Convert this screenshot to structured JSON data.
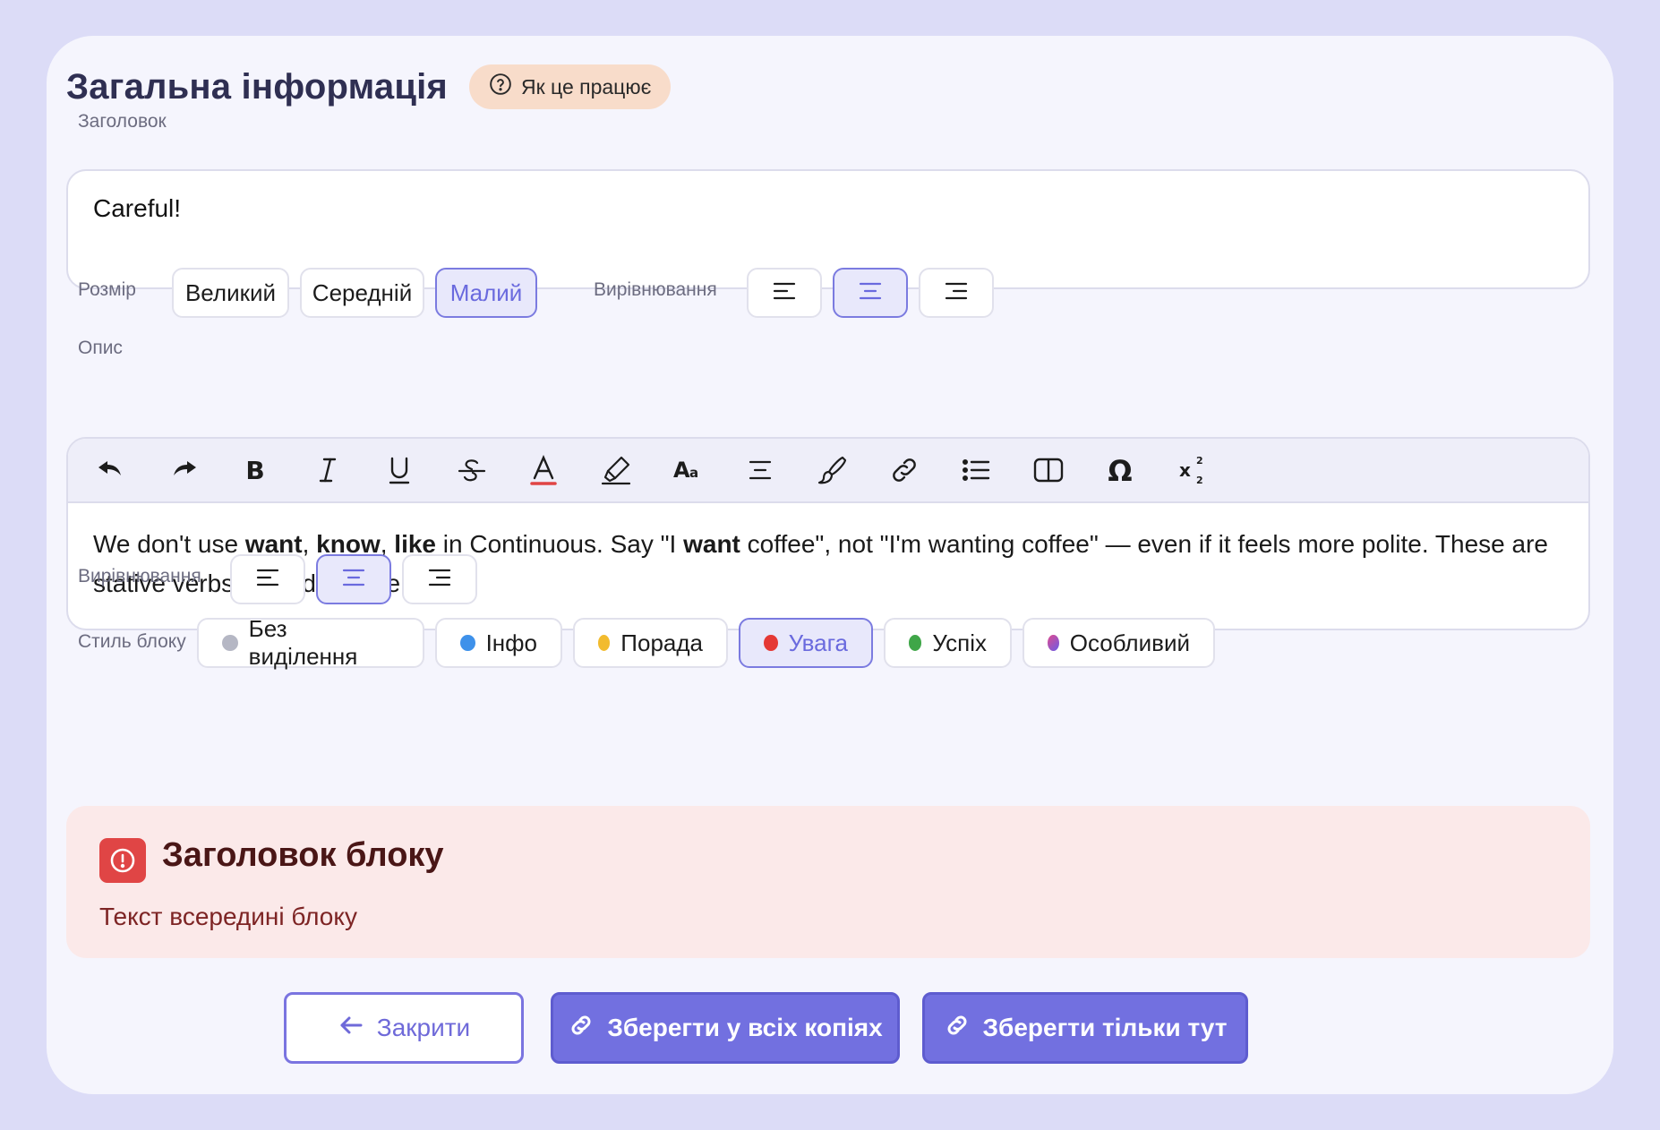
{
  "header": {
    "title": "Загальна інформація",
    "how_it_works": "Як це працює"
  },
  "heading_field": {
    "label": "Заголовок",
    "value": "Careful!"
  },
  "size": {
    "label": "Розмір",
    "options": [
      "Великий",
      "Середній",
      "Малий"
    ],
    "selected": "Малий"
  },
  "heading_alignment": {
    "label": "Вирівнювання",
    "selected": "center"
  },
  "description": {
    "label": "Опис",
    "toolbar": [
      "undo-icon",
      "redo-icon",
      "bold-icon",
      "italic-icon",
      "underline-icon",
      "strikethrough-icon",
      "font-color-icon",
      "highlight-icon",
      "font-size-icon",
      "align-icon",
      "format-brush-icon",
      "link-icon",
      "bullet-list-icon",
      "columns-icon",
      "special-char-icon",
      "superscript-subscript-icon"
    ],
    "text_parts": {
      "p1": "We don't use ",
      "b1": "want",
      "p2": ", ",
      "b2": "know",
      "p3": ", ",
      "b3": "like",
      "p4": " in Continuous. Say \"I ",
      "b4": "want",
      "p5": " coffee\", not \"I'm wanting coffee\" — even if it feels more polite. These are stative verbs, they don't like -ing."
    }
  },
  "text_alignment": {
    "label": "Вирівнювання",
    "selected": "center"
  },
  "block_style": {
    "label": "Стиль блоку",
    "options": [
      {
        "label": "Без виділення",
        "color": "#b5b7c4"
      },
      {
        "label": "Інфо",
        "color": "#3e91ea"
      },
      {
        "label": "Порада",
        "color": "#f2bb2e"
      },
      {
        "label": "Увага",
        "color": "#e53935"
      },
      {
        "label": "Успіх",
        "color": "#3fa648"
      },
      {
        "label": "Особливий",
        "color": "#8a5ce6"
      }
    ],
    "selected": "Увага"
  },
  "preview": {
    "title": "Заголовок блоку",
    "text": "Текст всередині блоку",
    "accent": "#e04545",
    "background": "#fbe9e9"
  },
  "footer": {
    "close": "Закрити",
    "save_all": "Зберегти у всіх копіях",
    "save_here": "Зберегти тільки тут"
  }
}
